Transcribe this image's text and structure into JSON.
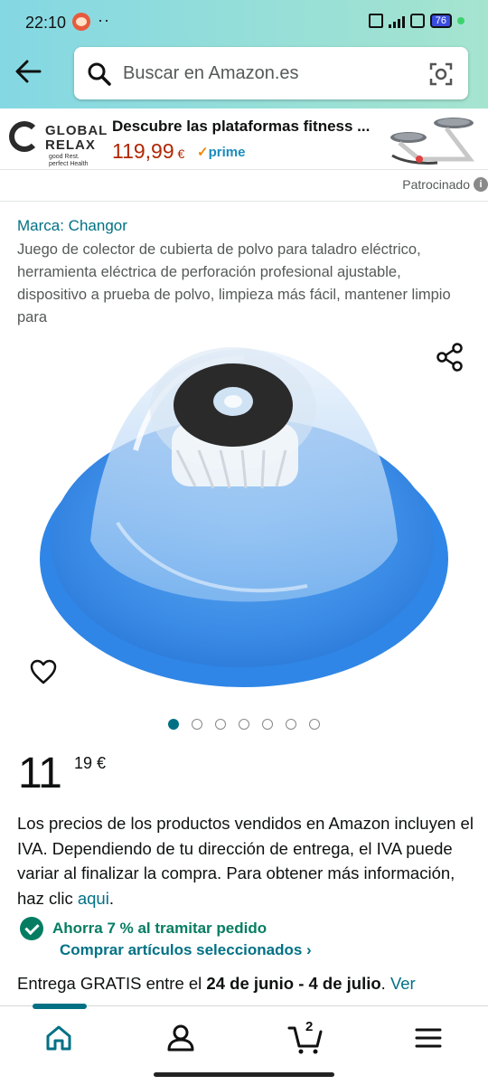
{
  "status_bar": {
    "time": "22:10",
    "dots": "··",
    "battery": "76"
  },
  "search": {
    "placeholder": "Buscar en Amazon.es"
  },
  "ad": {
    "logo_line1": "GLOBAL",
    "logo_line2": "RELAX",
    "logo_tagline1": "good Rest.",
    "logo_tagline2": "perfect Health",
    "title": "Descubre las plataformas fitness ...",
    "price": "119,99",
    "currency": "€",
    "prime_label": "prime",
    "sponsored_label": "Patrocinado"
  },
  "product": {
    "brand": "Marca: Changor",
    "title": "Juego de colector de cubierta de polvo para taladro eléctrico, herramienta eléctrica de perforación profesional ajustable, dispositivo a prueba de polvo, limpieza más fácil, mantener limpio para",
    "image_count": 7,
    "active_image": 1,
    "price_whole": "11",
    "price_fraction": "19 €"
  },
  "vat_notice": {
    "text": "Los precios de los productos vendidos en Amazon incluyen el IVA. Dependiendo de tu dirección de entrega, el IVA puede variar al finalizar la compra. Para obtener más información, haz clic",
    "link": "aqui",
    "end": "."
  },
  "promo": {
    "saving": "Ahorra 7 % al tramitar pedido",
    "select_link": "Comprar artículos seleccionados ›"
  },
  "delivery": {
    "prefix": "Entrega GRATIS entre el",
    "dates": "24 de junio - 4 de julio",
    "suffix": ".",
    "link": "Ver"
  },
  "nav": {
    "cart_count": "2"
  },
  "colors": {
    "link": "#007185",
    "price": "#b12704",
    "success": "#067d62",
    "prime": "#1a8cbc"
  }
}
